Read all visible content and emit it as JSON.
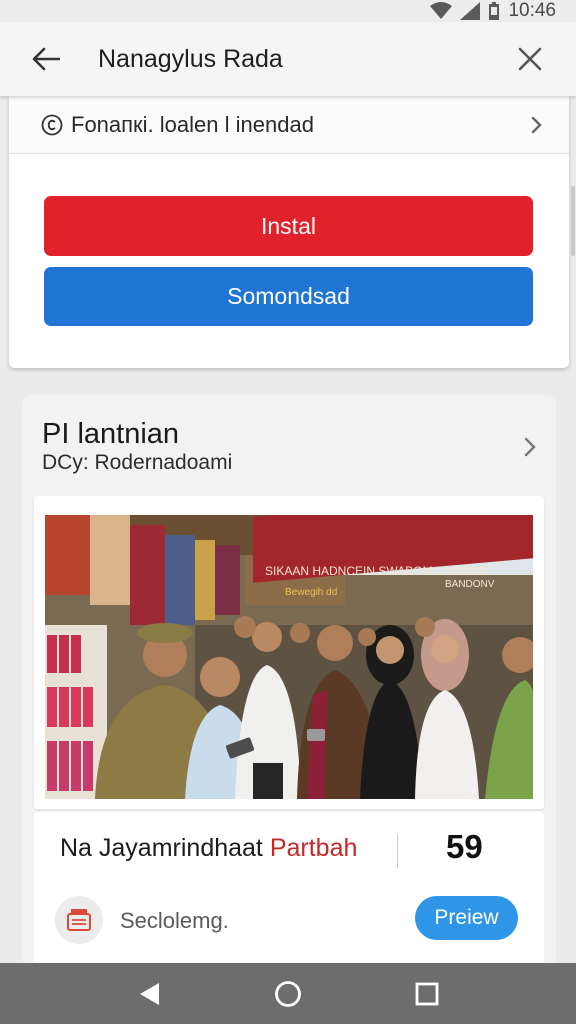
{
  "status_bar": {
    "time": "10:46"
  },
  "app_bar": {
    "title": "Nanagylus Rada"
  },
  "sheet": {
    "info_row_label": "Fonaпкi. loalen l inendad",
    "install_label": "Instal",
    "secondary_label": "Somondsad"
  },
  "card": {
    "title": "PI lantnian",
    "subtitle": "DCy: Rodernadoami",
    "photo_banner_text": "SIKAAN HADNCEIN SWABOM LABDBDE",
    "photo_banner_sub": "Bewegih dd",
    "photo_banner_sub2": "BANDONV",
    "footer": {
      "title_plain": "Na Jayamrindhaat ",
      "title_accent": "Partbah",
      "count": "59",
      "caption": "Seclolemg.",
      "preview_label": "Preiew"
    }
  },
  "colors": {
    "install": "#e2222a",
    "secondary": "#1f74d4",
    "preview": "#2f95e6",
    "accent_text": "#c62828",
    "nav_bar": "#6d6d6d"
  },
  "icons": [
    "wifi-icon",
    "signal-icon",
    "battery-icon",
    "back-arrow-icon",
    "close-icon",
    "info-icon",
    "chevron-right-icon",
    "card-chevron-icon",
    "shop-icon",
    "nav-back-icon",
    "nav-home-icon",
    "nav-recents-icon"
  ]
}
